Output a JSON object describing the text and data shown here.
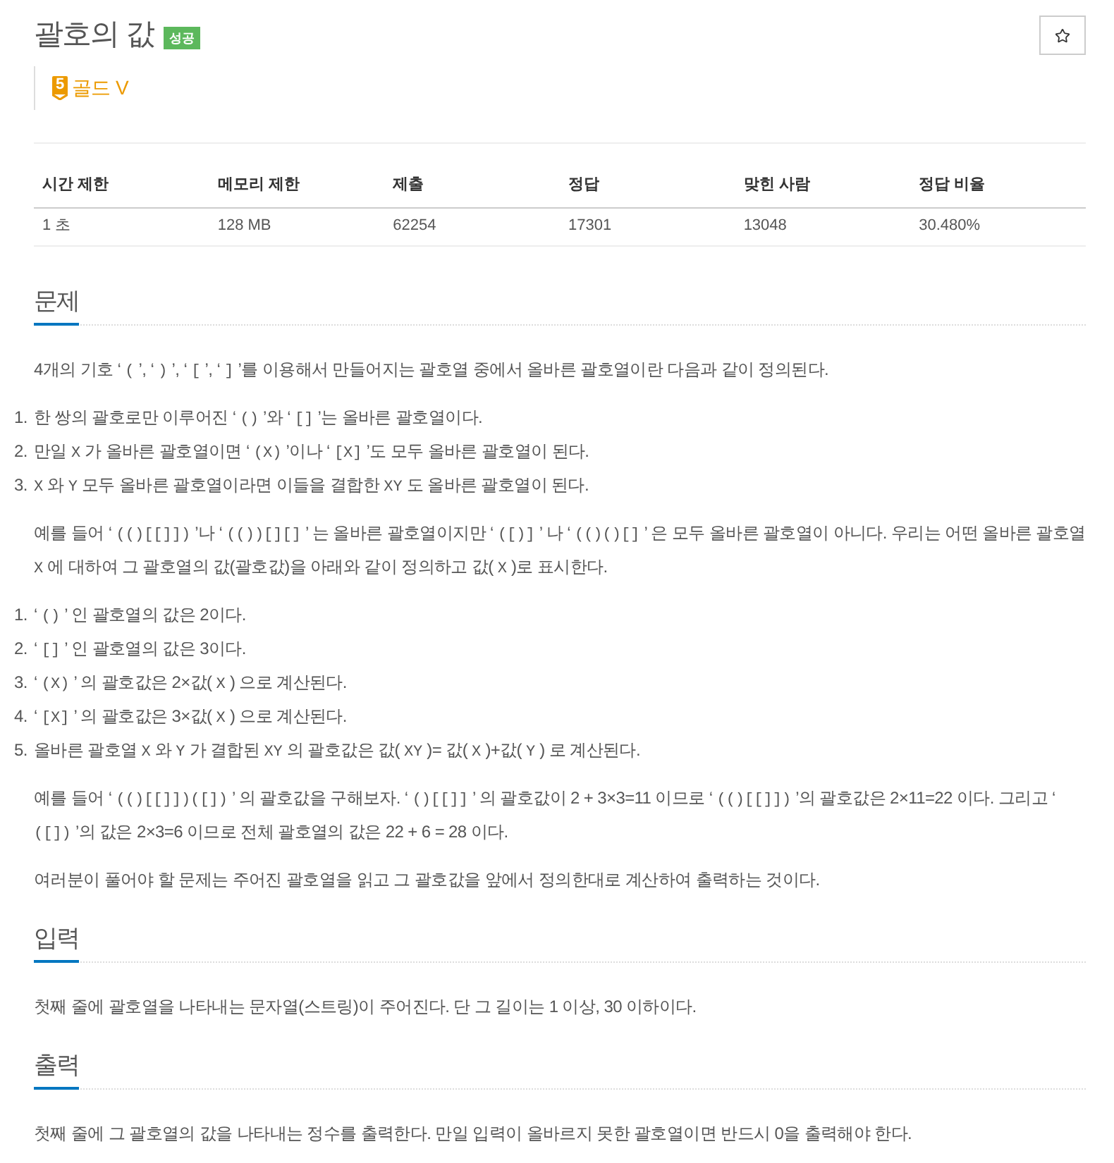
{
  "header": {
    "title": "괄호의 값",
    "status_badge": "성공",
    "tier": {
      "level": "5",
      "name": "골드 V"
    }
  },
  "info_table": {
    "columns": [
      "시간 제한",
      "메모리 제한",
      "제출",
      "정답",
      "맞힌 사람",
      "정답 비율"
    ],
    "rows": [
      [
        "1 초",
        "128 MB",
        "62254",
        "17301",
        "13048",
        "30.480%"
      ]
    ]
  },
  "sections": [
    {
      "heading": "문제",
      "blocks": [
        {
          "kind": "paragraph",
          "segments": [
            {
              "kind": "text",
              "text": "4개의 기호 ‘ "
            },
            {
              "kind": "code",
              "text": "("
            },
            {
              "kind": "text",
              "text": " ’, ‘ "
            },
            {
              "kind": "code",
              "text": ")"
            },
            {
              "kind": "text",
              "text": " ’, ‘ "
            },
            {
              "kind": "code",
              "text": "["
            },
            {
              "kind": "text",
              "text": " ’, ‘ "
            },
            {
              "kind": "code",
              "text": "]"
            },
            {
              "kind": "text",
              "text": " ’를 이용해서 만들어지는 괄호열 중에서 올바른 괄호열이란 다음과 같이 정의된다."
            }
          ]
        },
        {
          "kind": "list",
          "items": [
            {
              "number": "1.",
              "segments": [
                {
                  "kind": "text",
                  "text": "한 쌍의 괄호로만 이루어진 ‘ "
                },
                {
                  "kind": "code",
                  "text": "()"
                },
                {
                  "kind": "text",
                  "text": " ’와 ‘ "
                },
                {
                  "kind": "code",
                  "text": "[]"
                },
                {
                  "kind": "text",
                  "text": " ’는 올바른 괄호열이다."
                }
              ]
            },
            {
              "number": "2.",
              "segments": [
                {
                  "kind": "text",
                  "text": "만일 "
                },
                {
                  "kind": "code",
                  "text": "X"
                },
                {
                  "kind": "text",
                  "text": " 가 올바른 괄호열이면 ‘ "
                },
                {
                  "kind": "code",
                  "text": "(X)"
                },
                {
                  "kind": "text",
                  "text": " ’이나 ‘ "
                },
                {
                  "kind": "code",
                  "text": "[X]"
                },
                {
                  "kind": "text",
                  "text": " ’도 모두 올바른 괄호열이 된다."
                }
              ]
            },
            {
              "number": "3.",
              "segments": [
                {
                  "kind": "code",
                  "text": "X"
                },
                {
                  "kind": "text",
                  "text": " 와 "
                },
                {
                  "kind": "code",
                  "text": "Y"
                },
                {
                  "kind": "text",
                  "text": " 모두 올바른 괄호열이라면 이들을 결합한 "
                },
                {
                  "kind": "code",
                  "text": "XY"
                },
                {
                  "kind": "text",
                  "text": " 도 올바른 괄호열이 된다."
                }
              ]
            }
          ]
        },
        {
          "kind": "paragraph",
          "segments": [
            {
              "kind": "text",
              "text": "예를 들어 ‘ "
            },
            {
              "kind": "code",
              "text": "(()[[]])"
            },
            {
              "kind": "text",
              "text": " ’나 ‘ "
            },
            {
              "kind": "code",
              "text": "(())[][]"
            },
            {
              "kind": "text",
              "text": " ’ 는 올바른 괄호열이지만 ‘ "
            },
            {
              "kind": "code",
              "text": "([)]"
            },
            {
              "kind": "text",
              "text": " ’ 나 ‘ "
            },
            {
              "kind": "code",
              "text": "(()()[]"
            },
            {
              "kind": "text",
              "text": " ’ 은 모두 올바른 괄호열이 아니다. 우리는 어떤 올바른 괄호열 "
            },
            {
              "kind": "code",
              "text": "X"
            },
            {
              "kind": "text",
              "text": " 에 대하여 그 괄호열의 값(괄호값)을 아래와 같이 정의하고 값( "
            },
            {
              "kind": "code",
              "text": "X"
            },
            {
              "kind": "text",
              "text": " )로 표시한다."
            }
          ]
        },
        {
          "kind": "list",
          "items": [
            {
              "number": "1.",
              "segments": [
                {
                  "kind": "text",
                  "text": "‘ "
                },
                {
                  "kind": "code",
                  "text": "()"
                },
                {
                  "kind": "text",
                  "text": " ’ 인 괄호열의 값은 2이다."
                }
              ]
            },
            {
              "number": "2.",
              "segments": [
                {
                  "kind": "text",
                  "text": "‘ "
                },
                {
                  "kind": "code",
                  "text": "[]"
                },
                {
                  "kind": "text",
                  "text": " ’ 인 괄호열의 값은 3이다."
                }
              ]
            },
            {
              "number": "3.",
              "segments": [
                {
                  "kind": "text",
                  "text": "‘ "
                },
                {
                  "kind": "code",
                  "text": "(X)"
                },
                {
                  "kind": "text",
                  "text": " ’ 의 괄호값은 2×값( "
                },
                {
                  "kind": "code",
                  "text": "X"
                },
                {
                  "kind": "text",
                  "text": " ) 으로 계산된다."
                }
              ]
            },
            {
              "number": "4.",
              "segments": [
                {
                  "kind": "text",
                  "text": "‘ "
                },
                {
                  "kind": "code",
                  "text": "[X]"
                },
                {
                  "kind": "text",
                  "text": " ’ 의 괄호값은 3×값( "
                },
                {
                  "kind": "code",
                  "text": "X"
                },
                {
                  "kind": "text",
                  "text": " ) 으로 계산된다."
                }
              ]
            },
            {
              "number": "5.",
              "segments": [
                {
                  "kind": "text",
                  "text": "올바른 괄호열 "
                },
                {
                  "kind": "code",
                  "text": "X"
                },
                {
                  "kind": "text",
                  "text": " 와 "
                },
                {
                  "kind": "code",
                  "text": "Y"
                },
                {
                  "kind": "text",
                  "text": " 가 결합된 "
                },
                {
                  "kind": "code",
                  "text": "XY"
                },
                {
                  "kind": "text",
                  "text": " 의 괄호값은 값( "
                },
                {
                  "kind": "code",
                  "text": "XY"
                },
                {
                  "kind": "text",
                  "text": " )= 값( "
                },
                {
                  "kind": "code",
                  "text": "X"
                },
                {
                  "kind": "text",
                  "text": " )+값( "
                },
                {
                  "kind": "code",
                  "text": "Y"
                },
                {
                  "kind": "text",
                  "text": " ) 로 계산된다."
                }
              ]
            }
          ]
        },
        {
          "kind": "paragraph",
          "segments": [
            {
              "kind": "text",
              "text": "예를 들어 ‘ "
            },
            {
              "kind": "code",
              "text": "(()[[]])([])"
            },
            {
              "kind": "text",
              "text": " ’ 의 괄호값을 구해보자. ‘ "
            },
            {
              "kind": "code",
              "text": "()[[]]"
            },
            {
              "kind": "text",
              "text": " ’ 의 괄호값이 2 + 3×3=11 이므로 ‘ "
            },
            {
              "kind": "code",
              "text": "(()[[]])"
            },
            {
              "kind": "text",
              "text": " ’의 괄호값은 2×11=22 이다. 그리고 ‘ "
            },
            {
              "kind": "code",
              "text": "([])"
            },
            {
              "kind": "text",
              "text": " ’의 값은 2×3=6 이므로 전체 괄호열의 값은 22 + 6 = 28 이다."
            }
          ]
        },
        {
          "kind": "paragraph",
          "segments": [
            {
              "kind": "text",
              "text": "여러분이 풀어야 할 문제는 주어진 괄호열을 읽고 그 괄호값을 앞에서 정의한대로 계산하여 출력하는 것이다."
            }
          ]
        }
      ]
    },
    {
      "heading": "입력",
      "blocks": [
        {
          "kind": "paragraph",
          "segments": [
            {
              "kind": "text",
              "text": "첫째 줄에 괄호열을 나타내는 문자열(스트링)이 주어진다. 단 그 길이는 1 이상, 30 이하이다."
            }
          ]
        }
      ]
    },
    {
      "heading": "출력",
      "blocks": [
        {
          "kind": "paragraph",
          "segments": [
            {
              "kind": "text",
              "text": "첫째 줄에 그 괄호열의 값을 나타내는 정수를 출력한다. 만일 입력이 올바르지 못한 괄호열이면 반드시 0을 출력해야 한다."
            }
          ]
        }
      ]
    }
  ]
}
